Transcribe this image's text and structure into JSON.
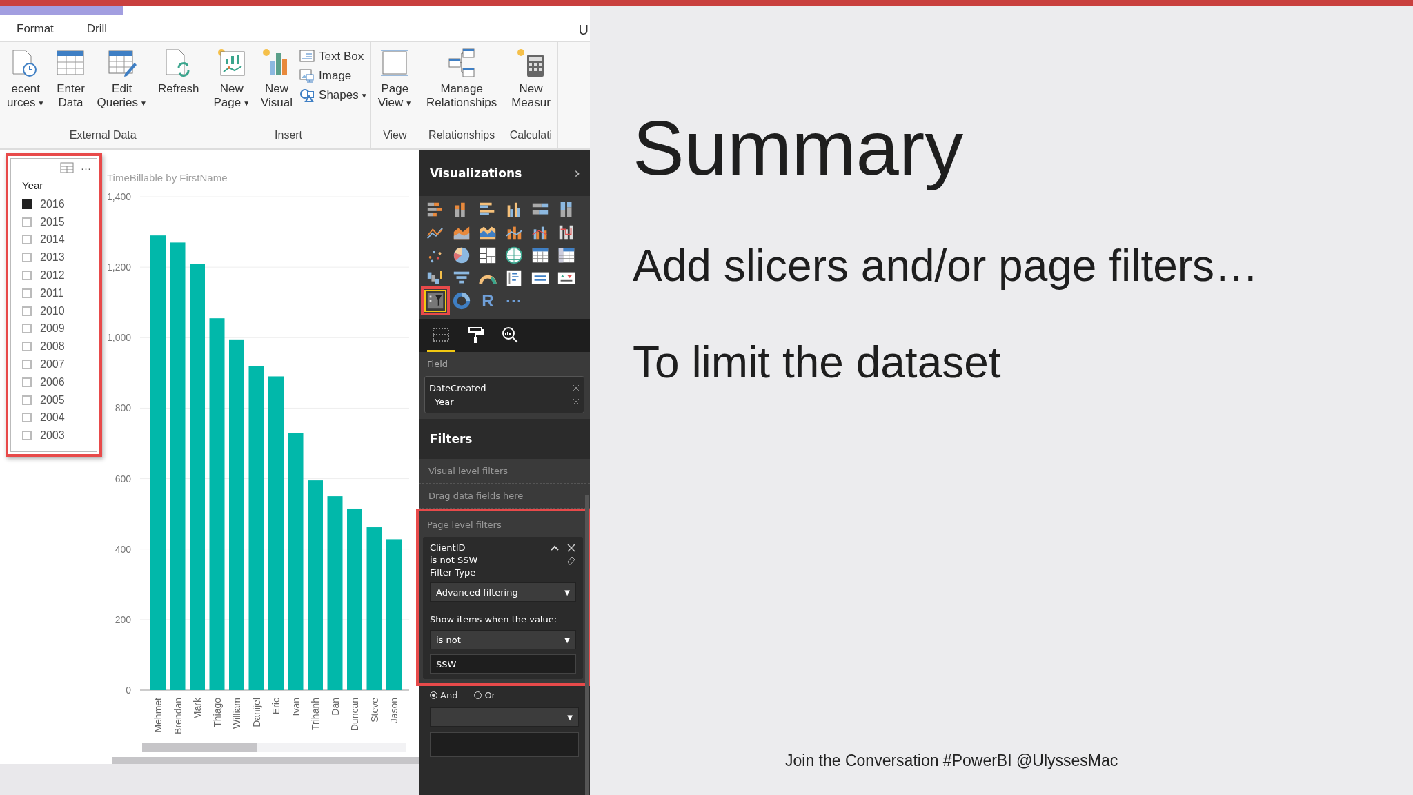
{
  "app": {
    "tab_strip": {
      "tabs": [
        {
          "label": "Format",
          "selected": false
        },
        {
          "label": "Drill",
          "selected": false
        }
      ],
      "right_label": "U"
    },
    "ribbon": {
      "groups": [
        {
          "label": "External Data",
          "buttons": [
            {
              "kind": "recent",
              "lines": [
                "ecent",
                "urces"
              ],
              "caret": "▼"
            },
            {
              "kind": "enter-data",
              "lines": [
                "Enter",
                "Data"
              ]
            },
            {
              "kind": "edit-queries",
              "lines": [
                "Edit",
                "Queries"
              ],
              "caret": "▼"
            },
            {
              "kind": "refresh",
              "lines": [
                "Refresh"
              ]
            }
          ]
        },
        {
          "label": "Insert",
          "buttons": [
            {
              "kind": "new-page",
              "lines": [
                "New",
                "Page"
              ],
              "caret": "▼"
            },
            {
              "kind": "new-visual",
              "lines": [
                "New",
                "Visual"
              ]
            }
          ],
          "small_buttons": [
            {
              "kind": "textbox",
              "label": "Text Box"
            },
            {
              "kind": "image",
              "label": "Image"
            },
            {
              "kind": "shapes",
              "label": "Shapes",
              "caret": "▼"
            }
          ]
        },
        {
          "label": "View",
          "buttons": [
            {
              "kind": "page-view",
              "lines": [
                "Page",
                "View"
              ],
              "caret": "▼"
            }
          ]
        },
        {
          "label": "Relationships",
          "buttons": [
            {
              "kind": "relationships",
              "lines": [
                "Manage",
                "Relationships"
              ]
            }
          ]
        },
        {
          "label": "Calculati",
          "buttons": [
            {
              "kind": "measure",
              "lines": [
                "New",
                "Measur"
              ]
            }
          ]
        }
      ]
    },
    "slicer": {
      "highlighted": true,
      "menu": "···",
      "title": "Year",
      "items": [
        {
          "label": "2016",
          "checked": true
        },
        {
          "label": "2015",
          "checked": false
        },
        {
          "label": "2014",
          "checked": false
        },
        {
          "label": "2013",
          "checked": false
        },
        {
          "label": "2012",
          "checked": false
        },
        {
          "label": "2011",
          "checked": false
        },
        {
          "label": "2010",
          "checked": false
        },
        {
          "label": "2009",
          "checked": false
        },
        {
          "label": "2008",
          "checked": false
        },
        {
          "label": "2007",
          "checked": false
        },
        {
          "label": "2006",
          "checked": false
        },
        {
          "label": "2005",
          "checked": false
        },
        {
          "label": "2004",
          "checked": false
        },
        {
          "label": "2003",
          "checked": false
        }
      ]
    },
    "chart": {
      "chart_data": {
        "type": "bar",
        "title": "TimeBillable by FirstName",
        "categories": [
          "Mehmet",
          "Brendan",
          "Mark",
          "Thiago",
          "William",
          "Danijel",
          "Eric",
          "Ivan",
          "Trihanh",
          "Dan",
          "Duncan",
          "Steve",
          "Jason"
        ],
        "grid": true,
        "series": [
          {
            "color": "#01b8aa",
            "values": [
              1290,
              1270,
              1210,
              1055,
              995,
              920,
              890,
              730,
              595,
              550,
              515,
              462,
              428
            ]
          }
        ],
        "ylim": [
          0,
          1400
        ],
        "yticks": [
          {
            "value": 0,
            "label": "0"
          },
          {
            "value": 200,
            "label": "200"
          },
          {
            "value": 400,
            "label": "400"
          },
          {
            "value": 600,
            "label": "600"
          },
          {
            "value": 800,
            "label": "800"
          },
          {
            "value": 1000,
            "label": "1,000"
          },
          {
            "value": 1200,
            "label": "1,200"
          },
          {
            "value": 1400,
            "label": "1,400"
          }
        ]
      }
    },
    "visualizations": {
      "title": "Visualizations",
      "expand": "›",
      "icons": [
        {
          "selected": false
        },
        {
          "selected": false
        },
        {
          "selected": false
        },
        {
          "selected": false
        },
        {
          "selected": false
        },
        {
          "selected": false
        },
        {
          "selected": false
        },
        {
          "selected": false
        },
        {
          "selected": false
        },
        {
          "selected": false
        },
        {
          "selected": false
        },
        {
          "selected": false
        },
        {
          "selected": false
        },
        {
          "selected": false
        },
        {
          "selected": false
        },
        {
          "selected": false
        },
        {
          "selected": false
        },
        {
          "selected": false
        },
        {
          "selected": false
        },
        {
          "selected": false
        },
        {
          "selected": false
        },
        {
          "selected": false
        },
        {
          "selected": false
        },
        {
          "selected": false
        },
        {
          "selected": true,
          "highlighted": true
        },
        {
          "selected": false
        },
        {
          "label": "R",
          "selected": false
        },
        {
          "label": "···",
          "selected": false
        }
      ],
      "pane_tabs": [
        {
          "selected": true
        },
        {
          "selected": false
        },
        {
          "selected": false
        }
      ],
      "field_label": "Field",
      "field_well": {
        "name": "DateCreated",
        "sub": "Year"
      }
    },
    "filters": {
      "title": "Filters",
      "visual_level": "Visual level filters",
      "drag_hint": "Drag data fields here",
      "page_level": {
        "label": "Page level filters",
        "highlighted": true,
        "card": {
          "field": "ClientID",
          "summary": "is not SSW",
          "filter_type_label": "Filter Type",
          "filter_type": "Advanced filtering",
          "filter_type_caret": "▼",
          "show_label": "Show items when the value:",
          "operator": "is not",
          "operator_caret": "▼",
          "value": "SSW",
          "next_operator_caret": "▼",
          "logic": [
            {
              "label": "And",
              "selected": true
            },
            {
              "label": "Or",
              "selected": false
            }
          ]
        }
      }
    }
  },
  "slide": {
    "title": "Summary",
    "points": [
      "Add slicers and/or page filters…",
      "To limit the dataset"
    ],
    "footer": "Join the Conversation #PowerBI @UlyssesMac"
  }
}
